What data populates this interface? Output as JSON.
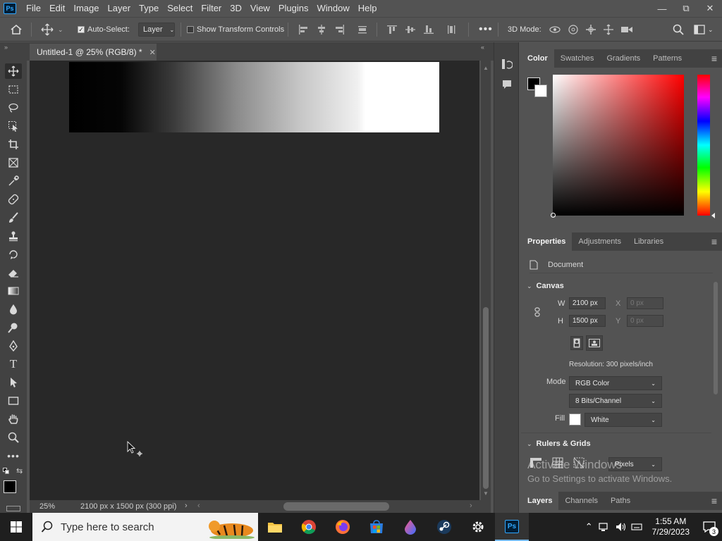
{
  "app": {
    "logo": "Ps"
  },
  "menu": [
    "File",
    "Edit",
    "Image",
    "Layer",
    "Type",
    "Select",
    "Filter",
    "3D",
    "View",
    "Plugins",
    "Window",
    "Help"
  ],
  "window_controls": {
    "minimize": "—",
    "restore": "⧉",
    "close": "✕"
  },
  "options_bar": {
    "auto_select_label": "Auto-Select:",
    "auto_select_checked": true,
    "auto_select_target": "Layer",
    "show_transform_label": "Show Transform Controls",
    "show_transform_checked": false,
    "mode_3d_label": "3D Mode:"
  },
  "document": {
    "tab_title": "Untitled-1 @ 25% (RGB/8) *",
    "zoom": "25%",
    "info": "2100 px x 1500 px (300 ppi)"
  },
  "color_panel": {
    "tabs": [
      "Color",
      "Swatches",
      "Gradients",
      "Patterns"
    ],
    "foreground": "#000000",
    "background": "#ffffff"
  },
  "properties": {
    "tabs": [
      "Properties",
      "Adjustments",
      "Libraries"
    ],
    "type_label": "Document",
    "canvas_section": "Canvas",
    "w_label": "W",
    "w_value": "2100 px",
    "h_label": "H",
    "h_value": "1500 px",
    "x_label": "X",
    "x_value": "0 px",
    "y_label": "Y",
    "y_value": "0 px",
    "resolution": "Resolution: 300 pixels/inch",
    "mode_label": "Mode",
    "mode_value": "RGB Color",
    "bits_value": "8 Bits/Channel",
    "fill_label": "Fill",
    "fill_value": "White",
    "rulers_section": "Rulers & Grids",
    "units_value": "Pixels"
  },
  "layers_panel": {
    "tabs": [
      "Layers",
      "Channels",
      "Paths"
    ]
  },
  "watermark": {
    "title": "Activate Windows",
    "subtitle": "Go to Settings to activate Windows."
  },
  "taskbar": {
    "search_placeholder": "Type here to search",
    "time": "1:55 AM",
    "date": "7/29/2023",
    "notification_count": "3"
  }
}
